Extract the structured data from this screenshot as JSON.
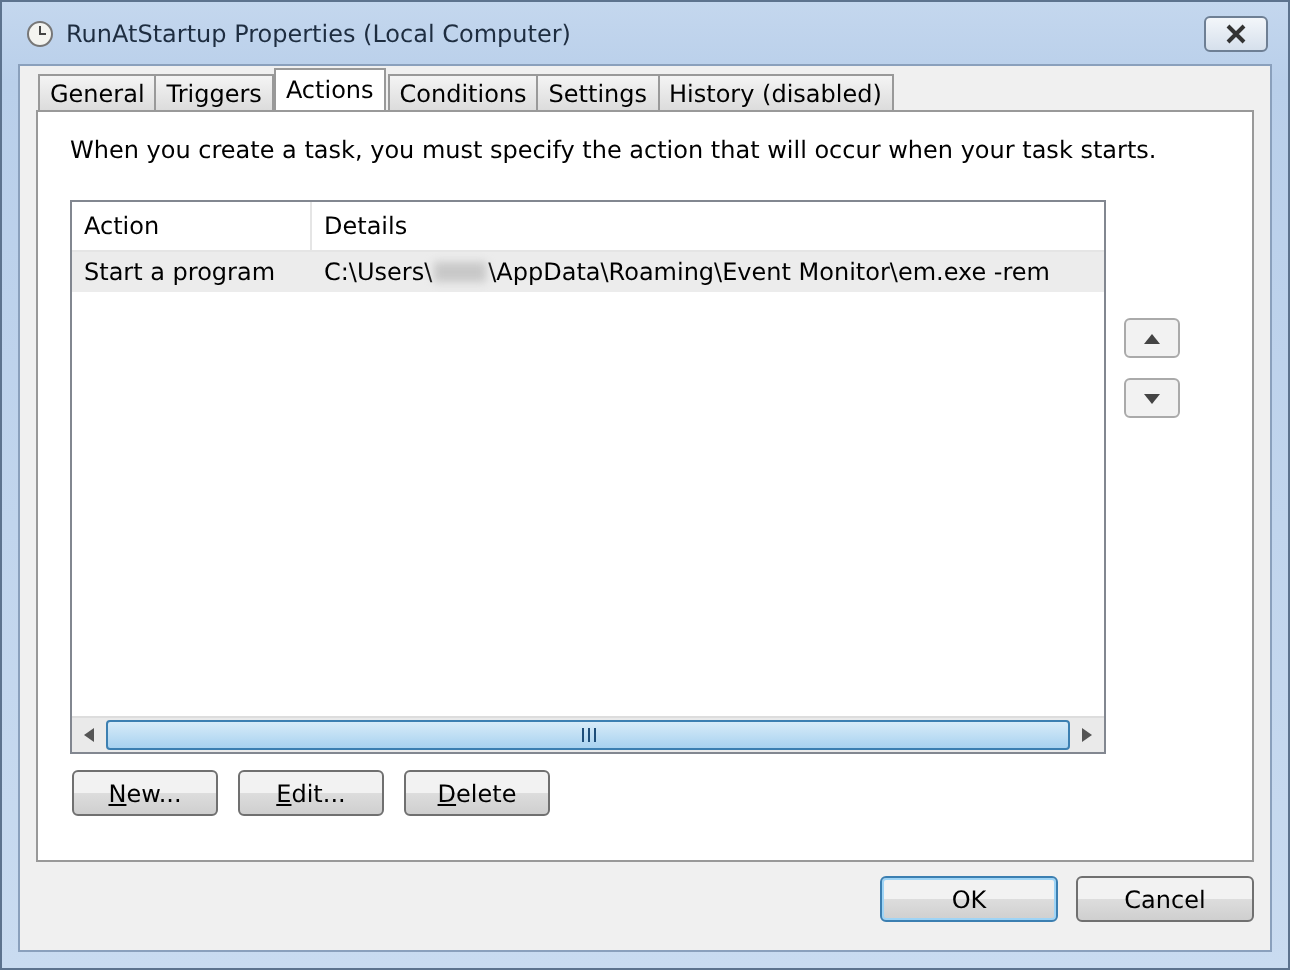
{
  "window": {
    "title": "RunAtStartup Properties (Local Computer)"
  },
  "tabs": [
    {
      "label": "General",
      "selected": false
    },
    {
      "label": "Triggers",
      "selected": false
    },
    {
      "label": "Actions",
      "selected": true
    },
    {
      "label": "Conditions",
      "selected": false
    },
    {
      "label": "Settings",
      "selected": false
    },
    {
      "label": "History (disabled)",
      "selected": false
    }
  ],
  "intro": "When you create a task, you must specify the action that will occur when your task starts.",
  "table": {
    "columns": [
      "Action",
      "Details"
    ],
    "rows": [
      {
        "selected": true,
        "action": "Start a program",
        "details_before": "C:\\Users\\",
        "details_redacted": true,
        "details_after": "\\AppData\\Roaming\\Event Monitor\\em.exe -rem"
      }
    ]
  },
  "list_buttons": [
    {
      "label": "New...",
      "underline_first": true
    },
    {
      "label": "Edit...",
      "underline_first": true
    },
    {
      "label": "Delete",
      "underline_first": true
    }
  ],
  "dialog_buttons": [
    {
      "label": "OK",
      "default": true
    },
    {
      "label": "Cancel",
      "default": false
    }
  ]
}
